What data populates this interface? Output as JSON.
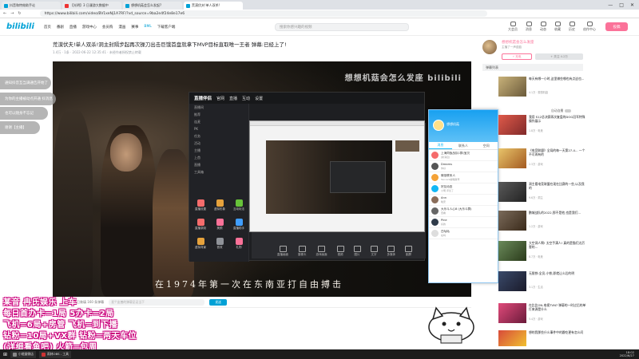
{
  "browser": {
    "tabs": [
      {
        "label": "抖音和特效助手论"
      },
      {
        "label": "【光明】3 日漫游大数据中"
      },
      {
        "label": "想想机菇会怎么发起?"
      },
      {
        "label": "荒漠伏夫!单人双杀!"
      }
    ],
    "url": "https://www.bilibili.com/video/BV1xeNj1A7RF/?vd_source=9ba2e4f24e8e17e6"
  },
  "bili": {
    "logo": "bilibili",
    "nav": [
      "首页",
      "番剧",
      "直播",
      "游戏中心",
      "会员购",
      "漫画",
      "赛事",
      "BML",
      "下载客户端"
    ],
    "search_placeholder": "搜索你感兴趣的视频",
    "right_nav": [
      "大会员",
      "消息",
      "动态",
      "收藏",
      "历史",
      "创作中心"
    ],
    "upload": "投稿"
  },
  "video": {
    "title": "荒漠伏夫!单人双杀!洞主封隔步起再次操刀出击巨饿首盘就拿下MVP目标直取唯一王者 弹幕:已经上了!",
    "meta": "1.4万  · 1条  · 2022-06-22 12:35:41  · 未经作者授权禁止转载",
    "watermark": "想想机菇会怎么发座  bilibili",
    "subtitle": "在1974年第一次在东南亚打自由搏击",
    "danmaku_placeholder": "发个友善的弹幕见证当下",
    "danmaku_send": "发送",
    "danmaku_count": "已装填 160 条弹幕"
  },
  "game_client": {
    "logo": "直播伴侣",
    "top_items": [
      "官网",
      "直播",
      "互动",
      "设置"
    ],
    "side_rows": [
      "直播间",
      "推荐",
      "连麦",
      "PK",
      "任务",
      "活动",
      "主播",
      "上首",
      "直播",
      "工具箱"
    ],
    "tiles": [
      "直播设置",
      "虚拟形象",
      "互动玩法",
      "直播录制",
      "美颜",
      "直播助手",
      "虚拟背景",
      "音效",
      "礼物"
    ],
    "bottom": [
      "直播画面",
      "摄像头",
      "游戏画面",
      "视频",
      "图片",
      "文字",
      "多媒体",
      "副屏"
    ]
  },
  "qq_panel": {
    "name": "想想机菇",
    "tabs": [
      "消息",
      "联系人",
      "空间"
    ],
    "items": [
      {
        "name": "上海同饭战队1群(宝贝",
        "msg": "[新消息]"
      },
      {
        "name": "Dreams",
        "msg": "你好"
      },
      {
        "name": "微信联系人",
        "msg": "Tencent邮箱账号"
      },
      {
        "name": "好友动态",
        "msg": "小明 评论了"
      },
      {
        "name": "Ann",
        "msg": "晚安"
      },
      {
        "name": "大乐斗人心8 (大乐斗群)",
        "msg": "查看"
      },
      {
        "name": "Pine",
        "msg": "好的"
      },
      {
        "name": "白咕咕",
        "msg": "在吗"
      }
    ]
  },
  "bubbles": [
    "通知抖音互当满通告开始了",
    "为你的主播被动点开通 抖消息",
    "也可以随身不忘记",
    "谢谢【主播】"
  ],
  "sidebar": {
    "up_name": "想想机菇会怎么发座",
    "up_sub": "主播了一声菇菇",
    "charge": "⚡ 充电",
    "follow": "+ 关注 4.2万",
    "playlist": "弹幕列表",
    "autoplay": "自动连播",
    "recs": [
      {
        "title": "每天有哪一小时,这里做些哪也有点这也...",
        "meta": "4.1万 · 想想机菇"
      },
      {
        "title": "我用 S12总决赛再次复盘的DOG冠军特殊操作展示",
        "meta": "1.8万 · 电竞"
      },
      {
        "title": "《电竞联盟》全局的每一天第27-4... 一个不可再有的",
        "meta": "2.3万 · 游戏"
      },
      {
        "title": "洞主看电竞联盟在现在比赛的一些,以及我的",
        "meta": "9.6万 · 洞主"
      },
      {
        "title": "鹏城战队的2022,那不是他,也是我们...",
        "meta": "1.2万 · 游戏"
      },
      {
        "title": "大空洞人啊! 太空手满人! 真的是猫们太厉害的...",
        "meta": "8.7万 · 电竞"
      },
      {
        "title": "无限铁:全员-小铁,即就让么后的明",
        "meta": "3.1万 · 生活"
      },
      {
        "title": "在比比ON-电视TVN? 弹幕的一时过后的单打来源是什么",
        "meta": "5.4万 · 游戏"
      },
      {
        "title": "想的我那些什么事件中的跟吃更有怎么问",
        "meta": "2.0万 · 娱乐"
      }
    ]
  },
  "overlays": {
    "line1": "某音  冉氏娱乐      上车",
    "line2": "每日首办卡=1局   5办卡=2局",
    "line3": "飞机=6局+房管     飞机=到下播",
    "line4": "钻粉=10局+VX群  钻粉=两天车位",
    "line5": "(详细看鱼吧)    火箭=包周"
  },
  "taskbar": {
    "items": [
      "小能量微店",
      "雨林OBS - 工具"
    ],
    "clock": "18:02\n2022/6/27"
  }
}
